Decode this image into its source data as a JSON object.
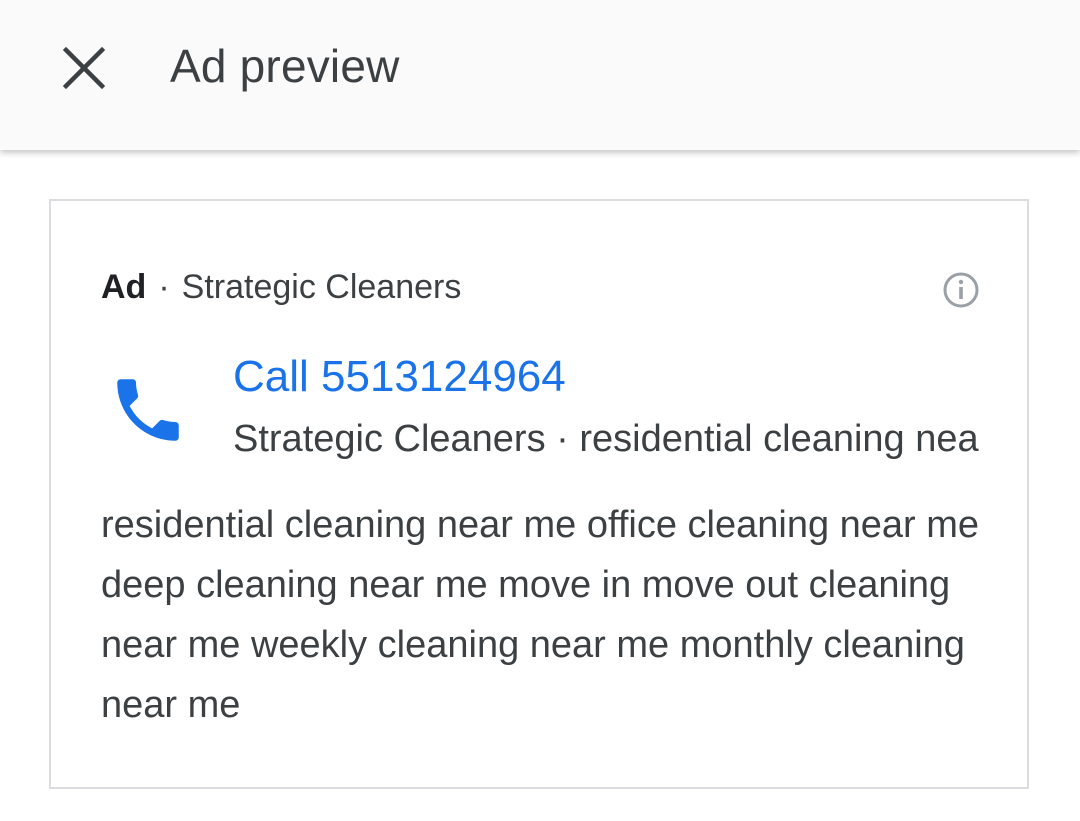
{
  "header": {
    "title": "Ad preview",
    "close_icon": "close-icon"
  },
  "ad": {
    "label": "Ad",
    "separator": "·",
    "advertiser": "Strategic Cleaners",
    "info_icon": "info-icon",
    "phone_icon": "phone-icon",
    "call_text": "Call 5513124964",
    "call_subline": "Strategic Cleaners · residential cleaning near me",
    "description": "residential cleaning near me office cleaning near me deep cleaning near me move in move out cleaning near me weekly cleaning near me monthly cleaning near me"
  },
  "colors": {
    "link_blue": "#1a73e8",
    "text_gray": "#3c4043",
    "border": "#dadce0"
  }
}
